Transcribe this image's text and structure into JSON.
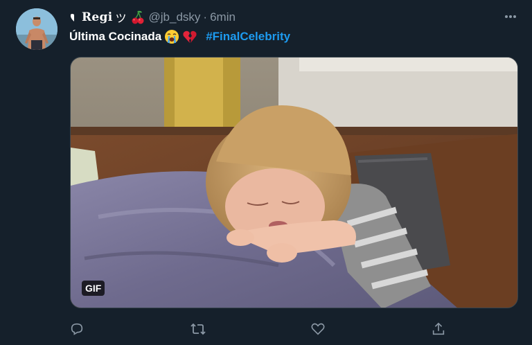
{
  "author": {
    "display_name": "Regi",
    "name_suffix": "ツ",
    "handle": "@jb_dsky",
    "separator": "·",
    "time": "6min",
    "avatar_icon": "avatar-photo",
    "name_prefix_icon": "heart-half-icon",
    "name_emoji_icon": "cherries-icon"
  },
  "tweet": {
    "text": "Última Cocinada",
    "emojis": [
      "loudly-crying-face-emoji",
      "broken-heart-emoji"
    ],
    "hashtag": "#FinalCelebrity"
  },
  "media": {
    "type": "gif",
    "badge": "GIF"
  },
  "actions": {
    "icons": [
      "reply-icon",
      "retweet-icon",
      "like-icon",
      "share-icon"
    ]
  },
  "colors": {
    "background": "#15202b",
    "text": "#ffffff",
    "secondary_text": "#8b98a5",
    "link": "#1d9bf0",
    "border": "#38444d"
  }
}
